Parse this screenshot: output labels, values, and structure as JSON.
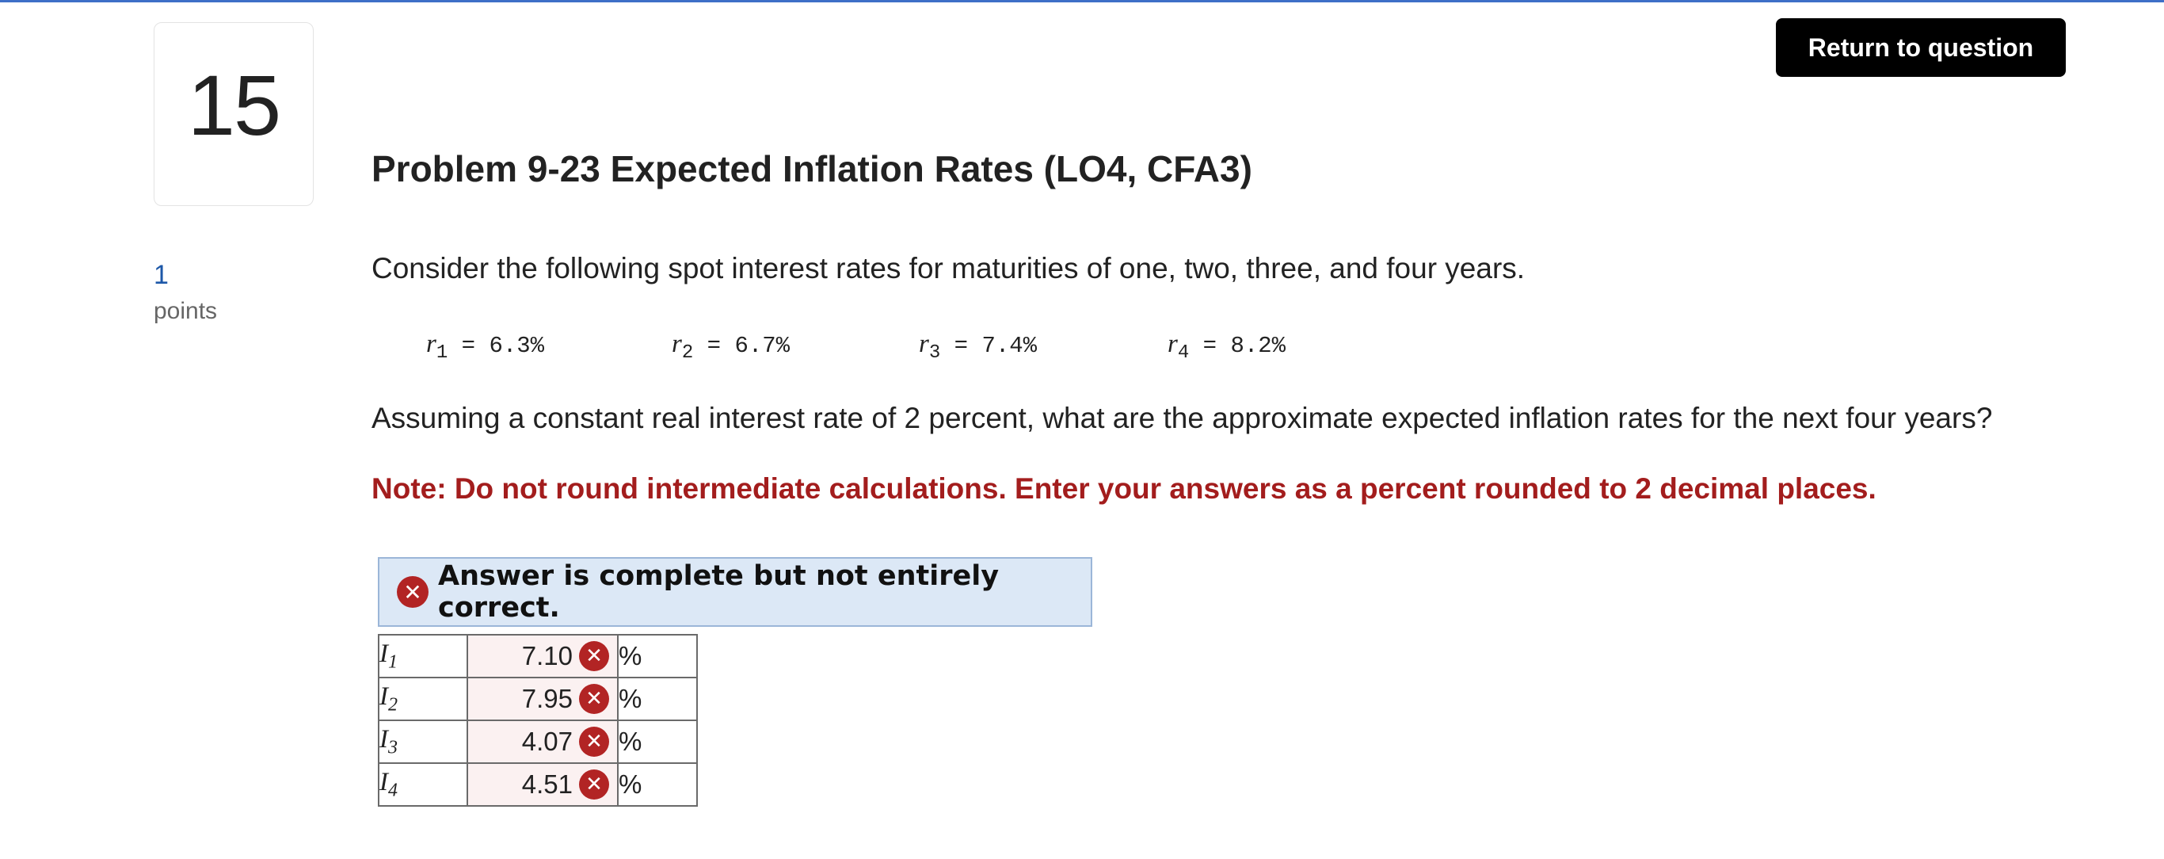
{
  "question_number": "15",
  "points": {
    "value": "1",
    "label": "points"
  },
  "return_button": "Return to question",
  "title": "Problem 9-23 Expected Inflation Rates (LO4, CFA3)",
  "intro": "Consider the following spot interest rates for maturities of one, two, three, and four years.",
  "rates": [
    {
      "var": "r",
      "sub": "1",
      "text": " = 6.3%"
    },
    {
      "var": "r",
      "sub": "2",
      "text": " = 6.7%"
    },
    {
      "var": "r",
      "sub": "3",
      "text": " = 7.4%"
    },
    {
      "var": "r",
      "sub": "4",
      "text": " = 8.2%"
    }
  ],
  "question": "Assuming a constant real interest rate of 2 percent, what are the approximate expected inflation rates for the next four years?",
  "note": "Note: Do not round intermediate calculations. Enter your answers as a percent rounded to 2 decimal places.",
  "banner": {
    "icon": "x-circle-icon",
    "text": "Answer is complete but not entirely correct."
  },
  "answers": [
    {
      "label": "I",
      "sub": "1",
      "value": "7.10",
      "unit": "%",
      "status": "incorrect"
    },
    {
      "label": "I",
      "sub": "2",
      "value": "7.95",
      "unit": "%",
      "status": "incorrect"
    },
    {
      "label": "I",
      "sub": "3",
      "value": "4.07",
      "unit": "%",
      "status": "incorrect"
    },
    {
      "label": "I",
      "sub": "4",
      "value": "4.51",
      "unit": "%",
      "status": "incorrect"
    }
  ],
  "colors": {
    "accent_rule": "#3e6fc7",
    "error": "#b22424",
    "note_red": "#a31d1d",
    "banner_bg": "#dce8f6",
    "points_blue": "#1d58a8"
  }
}
